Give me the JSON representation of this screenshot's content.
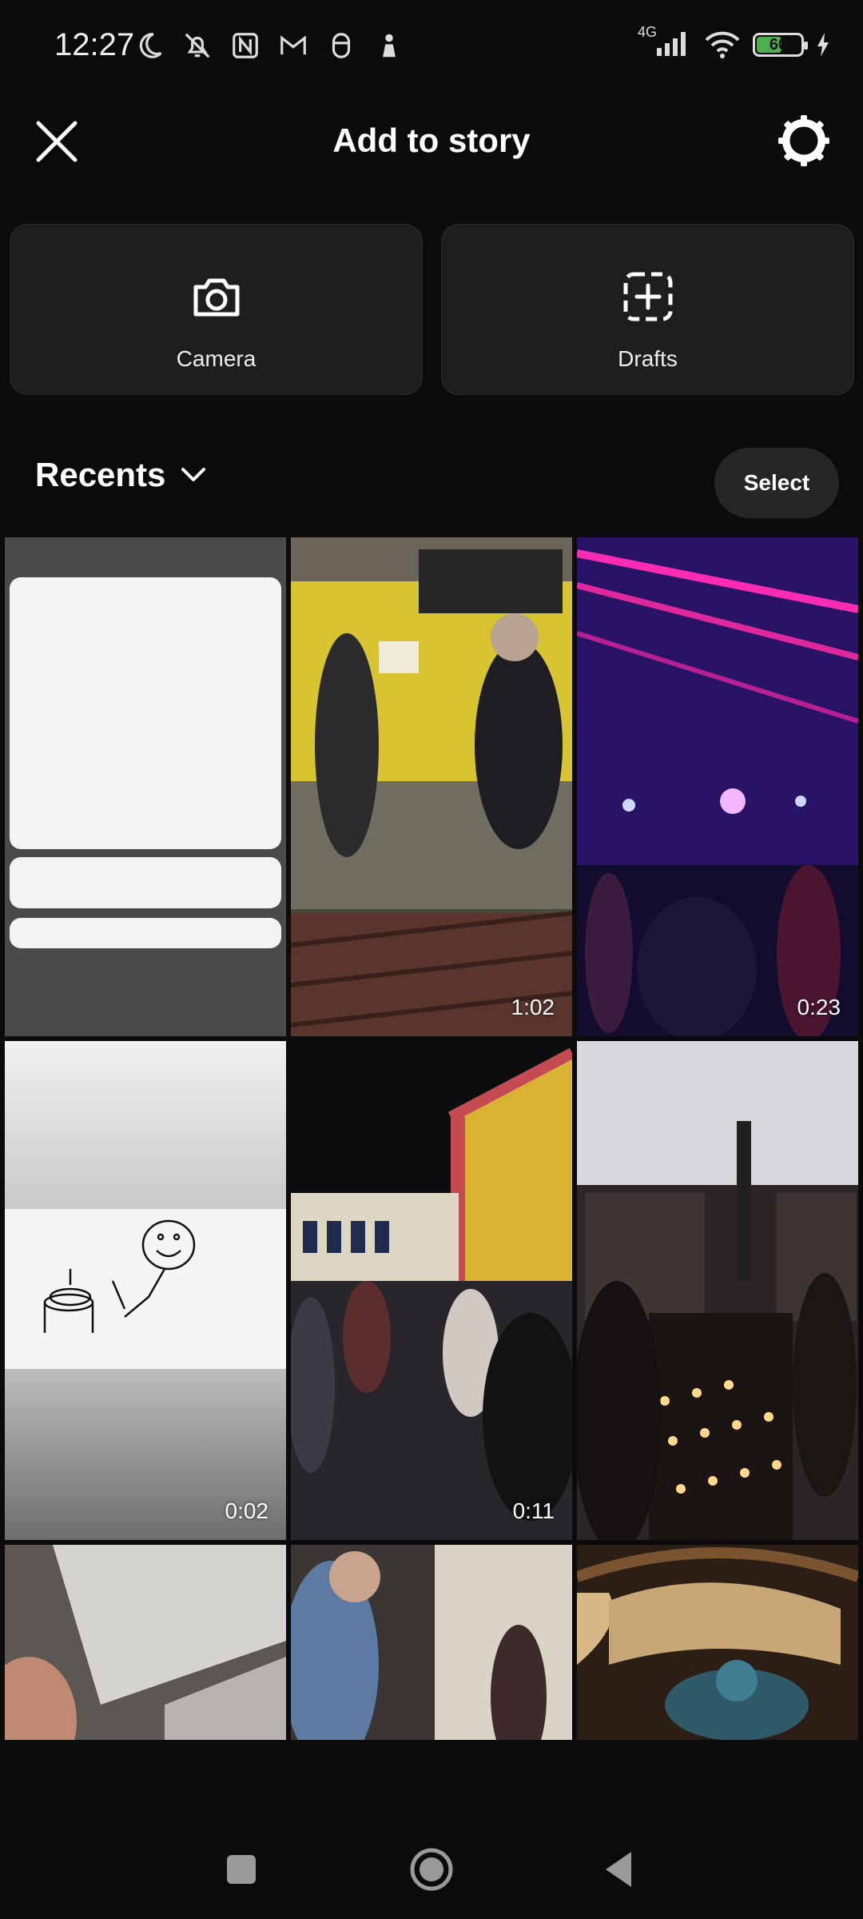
{
  "status_bar": {
    "time": "12:27",
    "network_type": "4G",
    "battery_level": "60",
    "battery_fraction": 0.6,
    "left_icons": [
      "moon-icon",
      "bell-off-icon",
      "nfc-icon",
      "gmail-icon",
      "app-icon",
      "person-icon"
    ],
    "right_icons": [
      "signal-icon",
      "wifi-icon",
      "battery-icon",
      "charging-icon"
    ]
  },
  "header": {
    "title": "Add to story",
    "close_icon": "close-icon",
    "settings_icon": "settings-icon"
  },
  "actions": [
    {
      "label": "Camera",
      "icon": "camera-icon"
    },
    {
      "label": "Drafts",
      "icon": "add-draft-icon"
    }
  ],
  "gallery": {
    "album": "Recents",
    "select_label": "Select",
    "items": [
      {
        "type": "image",
        "duration": ""
      },
      {
        "type": "video",
        "duration": "1:02"
      },
      {
        "type": "video",
        "duration": "0:23"
      },
      {
        "type": "video",
        "duration": "0:02"
      },
      {
        "type": "video",
        "duration": "0:11"
      },
      {
        "type": "image",
        "duration": ""
      },
      {
        "type": "image",
        "duration": ""
      },
      {
        "type": "image",
        "duration": ""
      },
      {
        "type": "image",
        "duration": ""
      }
    ]
  },
  "nav_bar": {
    "buttons": [
      "recents-square-icon",
      "home-circle-icon",
      "back-triangle-icon"
    ]
  },
  "colors": {
    "background": "#0b0b0b",
    "card": "#1e1e1e",
    "select_button": "#262626",
    "battery": "#4caf50"
  }
}
